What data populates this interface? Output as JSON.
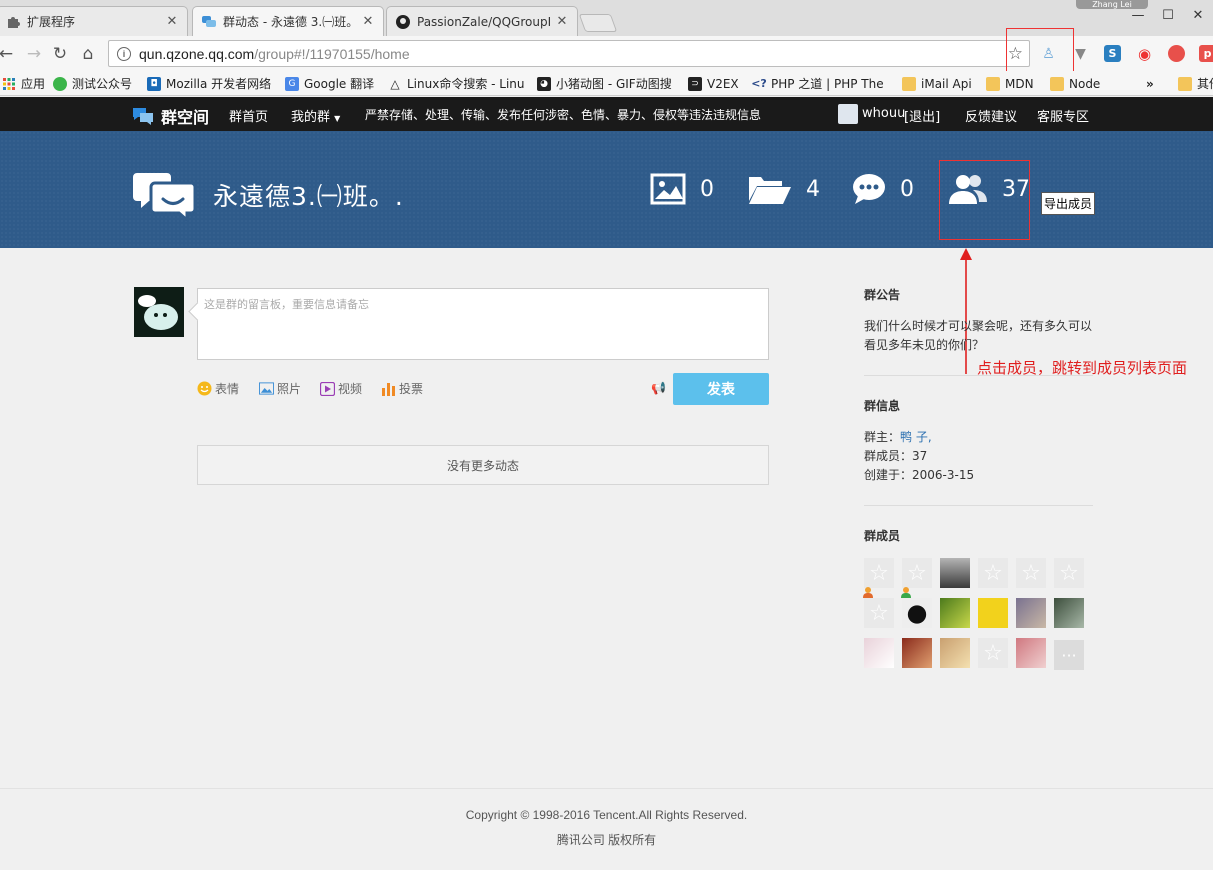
{
  "browser": {
    "tabs": [
      {
        "title": "扩展程序",
        "icon": "puzzle-icon"
      },
      {
        "title": "群动态 - 永遠德 3.㈠班。",
        "icon": "qun-icon"
      },
      {
        "title": "PassionZale/QQGroupI",
        "icon": "github-icon"
      }
    ],
    "profile_name": "Zhang Lei",
    "url_host": "qun.qzone.qq.com",
    "url_path": "/group#!/11970155/home",
    "bookmarks": [
      {
        "label": "应用",
        "icon": "apps-grid-icon"
      },
      {
        "label": "测试公众号",
        "icon": "wechat-icon"
      },
      {
        "label": "Mozilla 开发者网络",
        "icon": "mozilla-icon"
      },
      {
        "label": "Google 翻译",
        "icon": "translate-icon"
      },
      {
        "label": "Linux命令搜索 - Linu",
        "icon": "linux-icon"
      },
      {
        "label": "小猪动图 - GIF动图搜",
        "icon": "pig-icon"
      },
      {
        "label": "V2EX",
        "icon": "v2ex-icon"
      },
      {
        "label": "PHP 之道 | PHP The",
        "icon": "php-icon"
      },
      {
        "label": "iMail Api",
        "icon": "folder-icon"
      },
      {
        "label": "MDN",
        "icon": "folder-icon"
      },
      {
        "label": "Node",
        "icon": "folder-icon"
      },
      {
        "label": "»",
        "icon": ""
      },
      {
        "label": "其他",
        "icon": "folder-icon"
      }
    ]
  },
  "site_nav": {
    "brand": "群空间",
    "home": "群首页",
    "my_groups": "我的群",
    "notice": "严禁存储、处理、传输、发布任何涉密、色情、暴力、侵权等违法违规信息",
    "user": "whouu",
    "logout": "[退出]",
    "feedback": "反馈建议",
    "support": "客服专区"
  },
  "banner": {
    "group_name": "永遠德3.㈠班。.",
    "stats": {
      "photos": "0",
      "files": "4",
      "messages": "0",
      "members": "37"
    },
    "tooltip": "导出成员"
  },
  "post": {
    "placeholder": "这是群的留言板，重要信息请备忘",
    "tools": [
      "表情",
      "照片",
      "视频",
      "投票"
    ],
    "submit": "发表",
    "empty": "没有更多动态"
  },
  "sidebar": {
    "announcement_title": "群公告",
    "announcement_text_1": "我们什么时候才可以聚会呢，还有多久可以",
    "announcement_text_2": "看见多年未见的你们？",
    "annotation": "点击成员，跳转到成员列表页面",
    "info_title": "群信息",
    "owner_label": "群主：",
    "owner_name": "鸭 子,",
    "members_line": "群成员：37",
    "created_line": "创建于：2006-3-15",
    "members_title": "群成员"
  },
  "footer": {
    "copyright": "Copyright © 1998-2016 Tencent.All Rights Reserved.",
    "company": "腾讯公司 版权所有"
  },
  "colors": {
    "banner": "#2f5b8a",
    "submit": "#5cc0ec",
    "annotation": "#e02020"
  }
}
